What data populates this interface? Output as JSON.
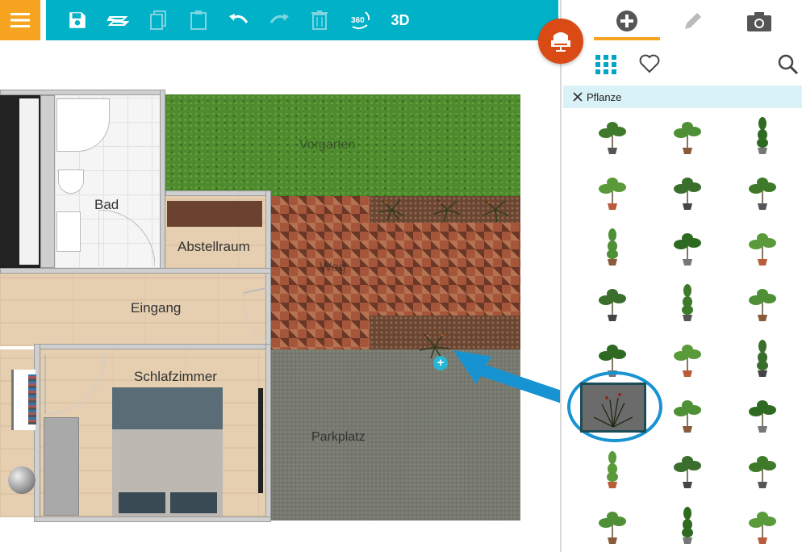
{
  "toolbar": {
    "tools": [
      {
        "id": "menu",
        "icon": "hamburger-menu-icon"
      },
      {
        "id": "save",
        "icon": "save-icon"
      },
      {
        "id": "layers",
        "icon": "layers-icon"
      },
      {
        "id": "copy",
        "icon": "copy-icon",
        "disabled": true
      },
      {
        "id": "paste",
        "icon": "paste-icon",
        "disabled": true
      },
      {
        "id": "undo",
        "icon": "undo-icon"
      },
      {
        "id": "redo",
        "icon": "redo-icon",
        "disabled": true
      },
      {
        "id": "delete",
        "icon": "trash-icon",
        "disabled": true
      },
      {
        "id": "view360",
        "icon": "360-view-icon"
      },
      {
        "id": "view3d",
        "label": "3D"
      }
    ]
  },
  "plan": {
    "rooms": {
      "bad": "Bad",
      "abstellraum": "Abstellraum",
      "eingang": "Eingang",
      "schlafzimmer": "Schlafzimmer"
    },
    "areas": {
      "vorgarten": "Vorgarten",
      "weg": "Weg",
      "parkplatz": "Parkplatz"
    }
  },
  "panel": {
    "tabs": [
      "add-icon",
      "pencil-icon",
      "camera-icon"
    ],
    "active_tab": 0,
    "filter": "Pflanze",
    "plants": [
      "plant-icon",
      "plant-icon",
      "plant-icon",
      "plant-icon",
      "plant-icon",
      "plant-icon",
      "plant-icon",
      "plant-icon",
      "plant-icon",
      "plant-icon",
      "plant-icon",
      "plant-icon",
      "plant-icon",
      "plant-icon",
      "plant-icon",
      "plant-icon",
      "plant-icon",
      "plant-icon",
      "plant-icon",
      "plant-icon",
      "plant-icon",
      "plant-icon",
      "plant-icon",
      "plant-icon"
    ],
    "selected_index": 15
  },
  "colors": {
    "toolbar": "#00b1c8",
    "menu": "#f7a520",
    "fab": "#d94a15",
    "accent": "#f7a520",
    "selection": "#1793d1",
    "filter_bg": "#d8f2f7"
  }
}
